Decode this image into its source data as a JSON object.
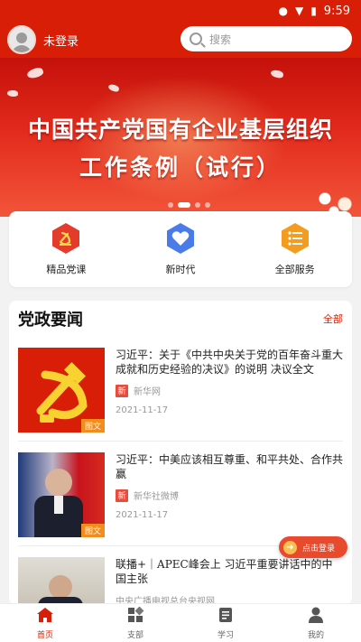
{
  "status_bar": {
    "time": "9:59"
  },
  "header": {
    "login_text": "未登录",
    "search_placeholder": "搜索"
  },
  "banner": {
    "line1": "中国共产党国有企业基层组织",
    "line2": "工作条例（试行）",
    "slide_count": 4,
    "active_slide": 2
  },
  "services": [
    {
      "label": "精品党课",
      "icon": "party-emblem-icon",
      "color": "#e33c2c"
    },
    {
      "label": "新时代",
      "icon": "heart-icon",
      "color": "#4a7be8"
    },
    {
      "label": "全部服务",
      "icon": "list-icon",
      "color": "#f39c1f"
    }
  ],
  "news": {
    "title": "党政要闻",
    "all_label": "全部",
    "items": [
      {
        "title": "习近平：关于《中共中央关于党的百年奋斗重大成就和历史经验的决议》的说明 决议全文",
        "source_badge": "新",
        "source": "新华网",
        "date": "2021-11-17",
        "tag": "图文"
      },
      {
        "title": "习近平：中美应该相互尊重、和平共处、合作共赢",
        "source_badge": "新",
        "source": "新华社微博",
        "date": "2021-11-17",
        "tag": "图文"
      },
      {
        "title": "联播+｜APEC峰会上 习近平重要讲话中的中国主张",
        "source": "中央广播电视总台央视网"
      }
    ]
  },
  "float_button": {
    "label": "点击登录"
  },
  "tabbar": [
    {
      "label": "首页",
      "icon": "home-icon",
      "active": true
    },
    {
      "label": "支部",
      "icon": "branch-icon",
      "active": false
    },
    {
      "label": "学习",
      "icon": "study-icon",
      "active": false
    },
    {
      "label": "我的",
      "icon": "profile-icon",
      "active": false
    }
  ],
  "colors": {
    "brand_red": "#d81e06",
    "accent_orange": "#f18d1e"
  }
}
